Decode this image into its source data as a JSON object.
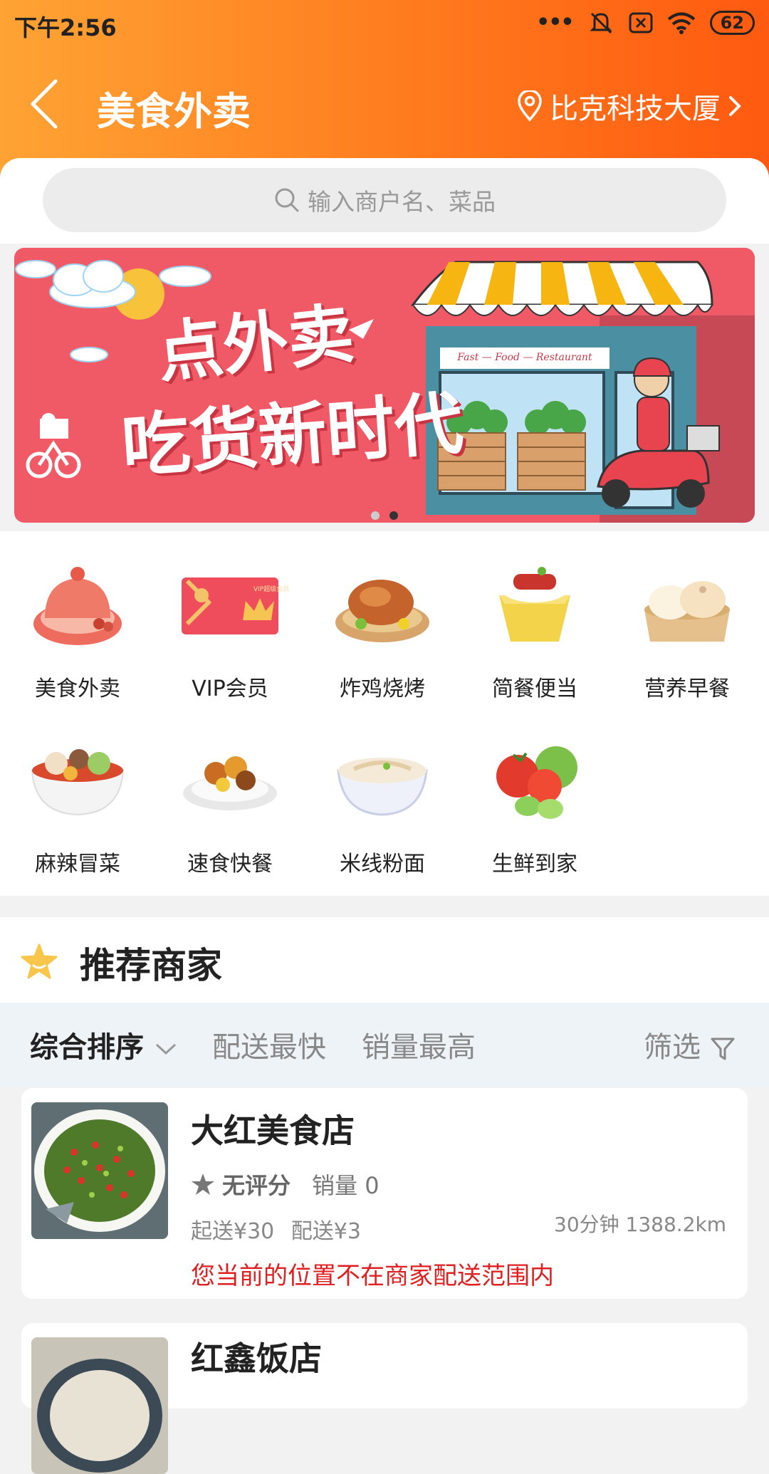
{
  "status": {
    "time": "下午2:56",
    "battery": "62"
  },
  "nav": {
    "title": "美食外卖",
    "location": "比克科技大厦"
  },
  "search": {
    "placeholder": "输入商户名、菜品"
  },
  "banner": {
    "line1": "点外卖",
    "line2": "吃货新时代",
    "sign": "Fast — Food — Restaurant",
    "page_count": 2,
    "active_page": 2
  },
  "categories": [
    {
      "label": "美食外卖",
      "icon": "food-cover-icon"
    },
    {
      "label": "VIP会员",
      "icon": "vip-card-icon",
      "card_text": "VIP超级会员"
    },
    {
      "label": "炸鸡烧烤",
      "icon": "roast-chicken-icon"
    },
    {
      "label": "简餐便当",
      "icon": "bento-box-icon"
    },
    {
      "label": "营养早餐",
      "icon": "steamed-bun-icon"
    },
    {
      "label": "麻辣冒菜",
      "icon": "spicy-bowl-icon"
    },
    {
      "label": "速食快餐",
      "icon": "rice-plate-icon"
    },
    {
      "label": "米线粉面",
      "icon": "noodle-bowl-icon"
    },
    {
      "label": "生鲜到家",
      "icon": "vegetables-icon"
    }
  ],
  "recommend": {
    "title": "推荐商家"
  },
  "sort": {
    "comprehensive": "综合排序",
    "fastest": "配送最快",
    "top_sales": "销量最高",
    "filter": "筛选"
  },
  "shops": [
    {
      "name": "大红美食店",
      "rating": "无评分",
      "sales": "销量 0",
      "min_order": "起送¥30",
      "delivery_fee": "配送¥3",
      "time_distance": "30分钟 1388.2km",
      "warning": "您当前的位置不在商家配送范围内"
    },
    {
      "name": "红鑫饭店"
    }
  ],
  "colors": {
    "header_start": "#ffa334",
    "header_end": "#ff5a10",
    "banner_bg": "#ef5a66",
    "warning": "#e02020",
    "star": "#f8c64a"
  }
}
